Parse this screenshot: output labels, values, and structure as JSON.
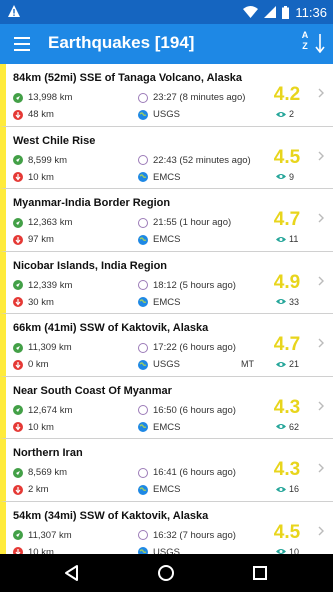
{
  "status": {
    "time": "11:36"
  },
  "appbar": {
    "title": "Earthquakes [194]",
    "sort_label": "A\nZ"
  },
  "colors": {
    "status_bar": "#1565c0",
    "app_bar": "#1e88e5",
    "magnitude": "#e8d51c",
    "accent_stripe": "#ffeb3b"
  },
  "icons": {
    "menu": "hamburger-menu-icon",
    "sort": "sort-alpha-icon",
    "distance": "green-location-icon",
    "depth": "red-down-arrow-icon",
    "time": "clock-icon",
    "source": "globe-icon",
    "views": "eye-icon",
    "open": "chevron-right-icon"
  },
  "quakes": [
    {
      "place": "84km (52mi) SSE of Tanaga Volcano, Alaska",
      "distance": "13,998 km",
      "depth": "48 km",
      "time": "23:27 (8 minutes ago)",
      "source": "USGS",
      "network": "",
      "magnitude": "4.2",
      "views": "2"
    },
    {
      "place": "West Chile Rise",
      "distance": "8,599 km",
      "depth": "10 km",
      "time": "22:43 (52 minutes ago)",
      "source": "EMCS",
      "network": "",
      "magnitude": "4.5",
      "views": "9"
    },
    {
      "place": "Myanmar-India Border Region",
      "distance": "12,363 km",
      "depth": "97 km",
      "time": "21:55 (1 hour ago)",
      "source": "EMCS",
      "network": "",
      "magnitude": "4.7",
      "views": "11"
    },
    {
      "place": "Nicobar Islands, India Region",
      "distance": "12,339 km",
      "depth": "30 km",
      "time": "18:12 (5 hours ago)",
      "source": "EMCS",
      "network": "",
      "magnitude": "4.9",
      "views": "33"
    },
    {
      "place": "66km (41mi) SSW of Kaktovik, Alaska",
      "distance": "11,309 km",
      "depth": "0 km",
      "time": "17:22 (6 hours ago)",
      "source": "USGS",
      "network": "MT",
      "magnitude": "4.7",
      "views": "21"
    },
    {
      "place": "Near South Coast Of Myanmar",
      "distance": "12,674 km",
      "depth": "10 km",
      "time": "16:50 (6 hours ago)",
      "source": "EMCS",
      "network": "",
      "magnitude": "4.3",
      "views": "62"
    },
    {
      "place": "Northern Iran",
      "distance": "8,569 km",
      "depth": "2 km",
      "time": "16:41 (6 hours ago)",
      "source": "EMCS",
      "network": "",
      "magnitude": "4.3",
      "views": "16"
    },
    {
      "place": "54km (34mi) SSW of Kaktovik, Alaska",
      "distance": "11,307 km",
      "depth": "10 km",
      "time": "16:32 (7 hours ago)",
      "source": "USGS",
      "network": "",
      "magnitude": "4.5",
      "views": "10"
    }
  ]
}
